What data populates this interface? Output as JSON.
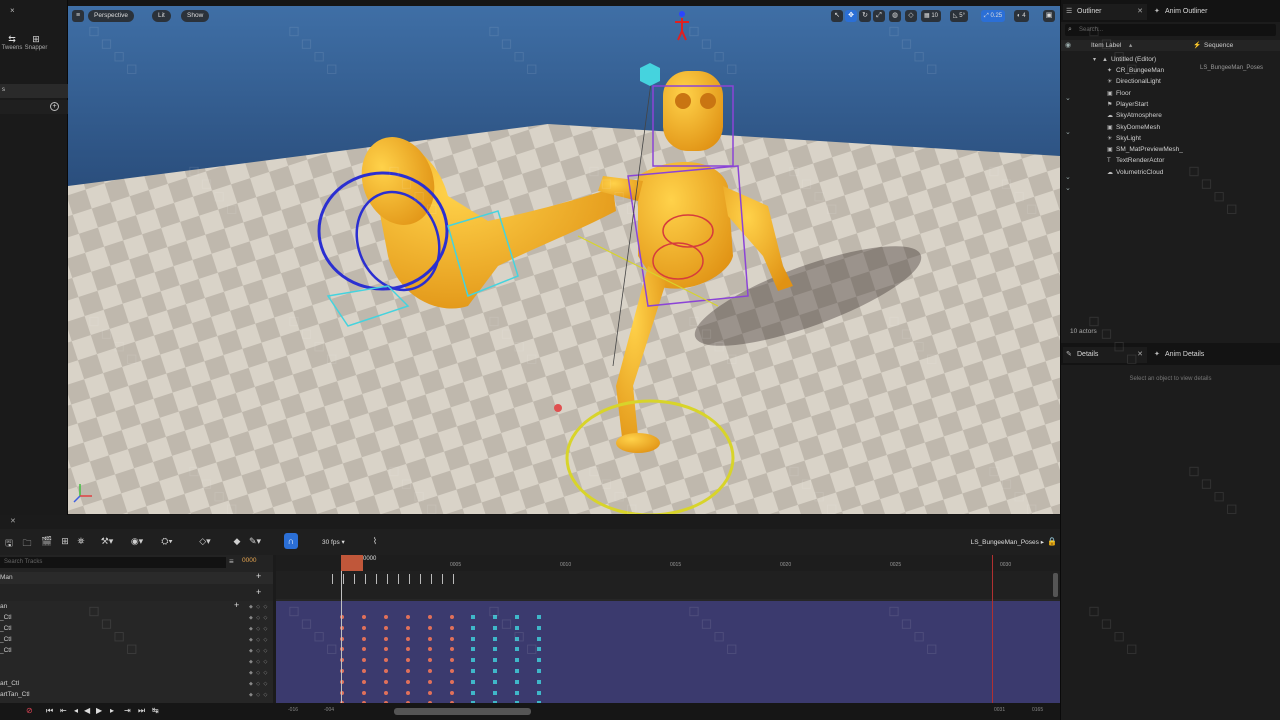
{
  "left_panel": {
    "close_label": "×",
    "tools": [
      {
        "icon": "tweens-icon",
        "glyph": "⇆",
        "label": "Tweens"
      },
      {
        "icon": "snapper-icon",
        "glyph": "⊞",
        "label": "Snapper"
      }
    ],
    "section_label": "s"
  },
  "viewport": {
    "menu_icon": "hamburger-menu-icon",
    "perspective_label": "Perspective",
    "lit_label": "Lit",
    "show_label": "Show",
    "grid_snap_value": "10",
    "rotation_snap_value": "5°",
    "scale_snap_value": "0.25",
    "camera_speed_value": "4"
  },
  "outliner": {
    "tabs": [
      {
        "label": "Outliner",
        "icon": "outliner-icon",
        "active": true
      },
      {
        "label": "Anim Outliner",
        "icon": "anim-outliner-icon",
        "active": false
      }
    ],
    "search_placeholder": "Search...",
    "columns": {
      "item_label": "Item Label",
      "sequence": "Sequence"
    },
    "root": "Untitled (Editor)",
    "items": [
      {
        "label": "CR_BungeeMan",
        "icon": "skeletal-icon",
        "sequence": "LS_BungeeMan_Poses"
      },
      {
        "label": "DirectionalLight",
        "icon": "light-icon",
        "sequence": ""
      },
      {
        "label": "Floor",
        "icon": "mesh-icon",
        "sequence": ""
      },
      {
        "label": "PlayerStart",
        "icon": "player-start-icon",
        "sequence": ""
      },
      {
        "label": "SkyAtmosphere",
        "icon": "sky-icon",
        "sequence": ""
      },
      {
        "label": "SkyDomeMesh",
        "icon": "mesh-icon",
        "sequence": ""
      },
      {
        "label": "SkyLight",
        "icon": "light-icon",
        "sequence": ""
      },
      {
        "label": "SM_MatPreviewMesh_",
        "icon": "mesh-icon",
        "sequence": ""
      },
      {
        "label": "TextRenderActor",
        "icon": "text-icon",
        "sequence": ""
      },
      {
        "label": "VolumetricCloud",
        "icon": "cloud-icon",
        "sequence": ""
      }
    ],
    "actor_count": "10 actors"
  },
  "details": {
    "tabs": [
      {
        "label": "Details",
        "icon": "details-icon",
        "active": true
      },
      {
        "label": "Anim Details",
        "icon": "anim-details-icon",
        "active": false
      }
    ],
    "hint": "Select an object to view details"
  },
  "sequencer": {
    "fps_label": "30 fps",
    "sequence_name": "LS_BungeeMan_Poses",
    "track_search_placeholder": "Search Tracks",
    "current_frame": "0000",
    "playhead_label": "0000",
    "ruler_labels": [
      "0005",
      "0010",
      "0015",
      "0020",
      "0025",
      "0030"
    ],
    "tracks": [
      {
        "label": "Man"
      },
      {
        "label": "an"
      },
      {
        "label": "_Ctl"
      },
      {
        "label": "_Ctl"
      },
      {
        "label": "_Ctl"
      },
      {
        "label": "_Ctl"
      },
      {
        "label": "art_Ctl"
      },
      {
        "label": "artTan_Ctl"
      }
    ],
    "range_start": "-016",
    "range_start_inner": "-004",
    "range_end_inner": "0031",
    "range_end": "0165"
  },
  "colors": {
    "accent": "#2b6fd6",
    "key_red": "#e0705a",
    "key_cyan": "#3fb7c9",
    "section_purple": "#3b3a6e",
    "playhead": "#c0573a"
  }
}
